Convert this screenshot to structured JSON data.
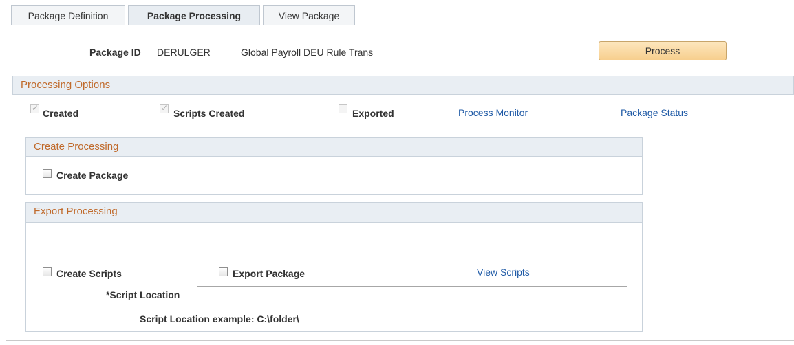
{
  "tabs": [
    {
      "label": "Package Definition",
      "active": false
    },
    {
      "label": "Package Processing",
      "active": true
    },
    {
      "label": "View Package",
      "active": false
    }
  ],
  "header": {
    "package_id_label": "Package ID",
    "package_id_value": "DERULGER",
    "package_description": "Global Payroll DEU Rule Trans",
    "process_button": "Process"
  },
  "processing_options": {
    "title": "Processing Options",
    "created": {
      "label": "Created",
      "checked": true,
      "disabled": true
    },
    "scripts_created": {
      "label": "Scripts Created",
      "checked": true,
      "disabled": true
    },
    "exported": {
      "label": "Exported",
      "checked": false,
      "disabled": true
    },
    "process_monitor_link": "Process Monitor",
    "package_status_link": "Package Status"
  },
  "create_processing": {
    "title": "Create Processing",
    "create_package": {
      "label": "Create Package",
      "checked": false
    }
  },
  "export_processing": {
    "title": "Export Processing",
    "create_scripts": {
      "label": "Create Scripts",
      "checked": false
    },
    "export_package": {
      "label": "Export Package",
      "checked": false
    },
    "view_scripts_link": "View Scripts",
    "script_location_label": "*Script Location",
    "script_location_value": "",
    "script_location_example": "Script Location example: C:\\folder\\"
  },
  "colors": {
    "section_title": "#c06a2b",
    "link": "#1f5aa6",
    "button_gradient_top": "#fde6bd",
    "button_gradient_bottom": "#f7cf8e"
  }
}
